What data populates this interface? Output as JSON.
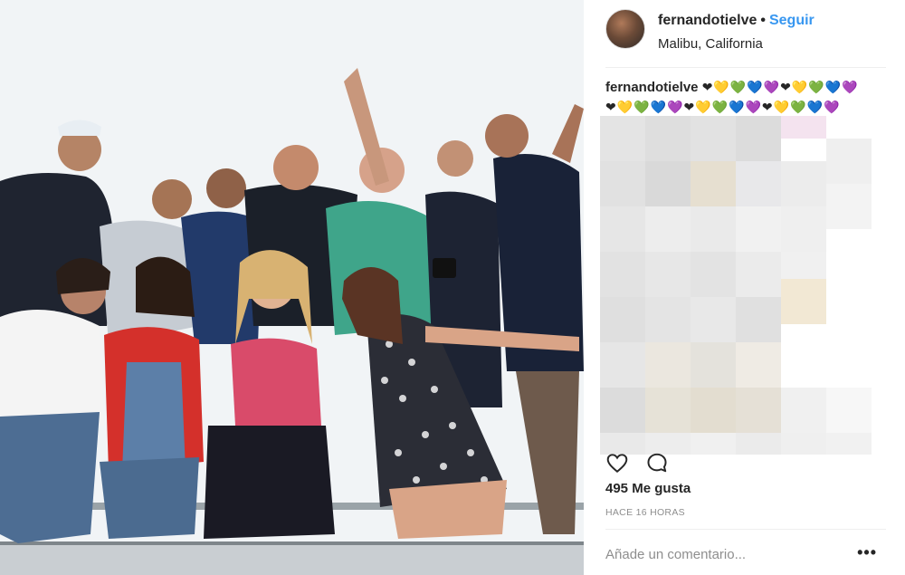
{
  "post": {
    "username": "fernandotielve",
    "separator": "•",
    "follow_label": "Seguir",
    "location": "Malibu, California",
    "caption_user": "fernandotielve",
    "caption_emojis_line1": "❤💛💚💙💜❤💛💚💙💜",
    "caption_emojis_line2": "❤💛💚💙💜❤💛💚💙💜❤💛💚💙💜",
    "likes": "495 Me gusta",
    "time": "HACE 16 HORAS",
    "comment_placeholder": "Añade un comentario...",
    "more_label": "•••",
    "photo_alt": "group photo"
  },
  "icons": {
    "like": "heart-icon",
    "comment": "comment-icon",
    "more": "more-options-icon"
  },
  "colors": {
    "link": "#3897f0",
    "text": "#262626",
    "muted": "#8e8e8e",
    "divider": "#efefef"
  }
}
